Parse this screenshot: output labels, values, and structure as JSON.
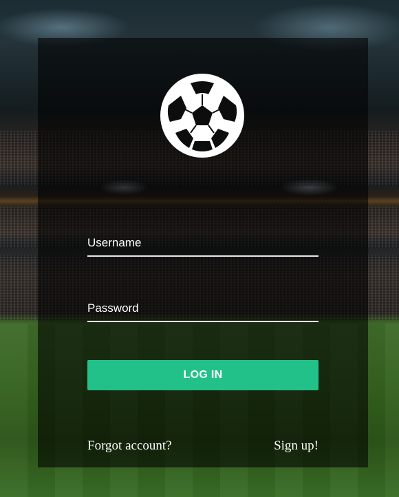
{
  "login": {
    "logo_icon": "soccer-ball-icon",
    "username": {
      "label": "Username",
      "value": ""
    },
    "password": {
      "label": "Password",
      "value": ""
    },
    "submit_label": "LOG IN",
    "forgot_label": "Forgot account?",
    "signup_label": "Sign up!"
  },
  "colors": {
    "accent": "#22c189",
    "panel": "rgba(0,0,0,0.58)",
    "text": "#ffffff"
  }
}
